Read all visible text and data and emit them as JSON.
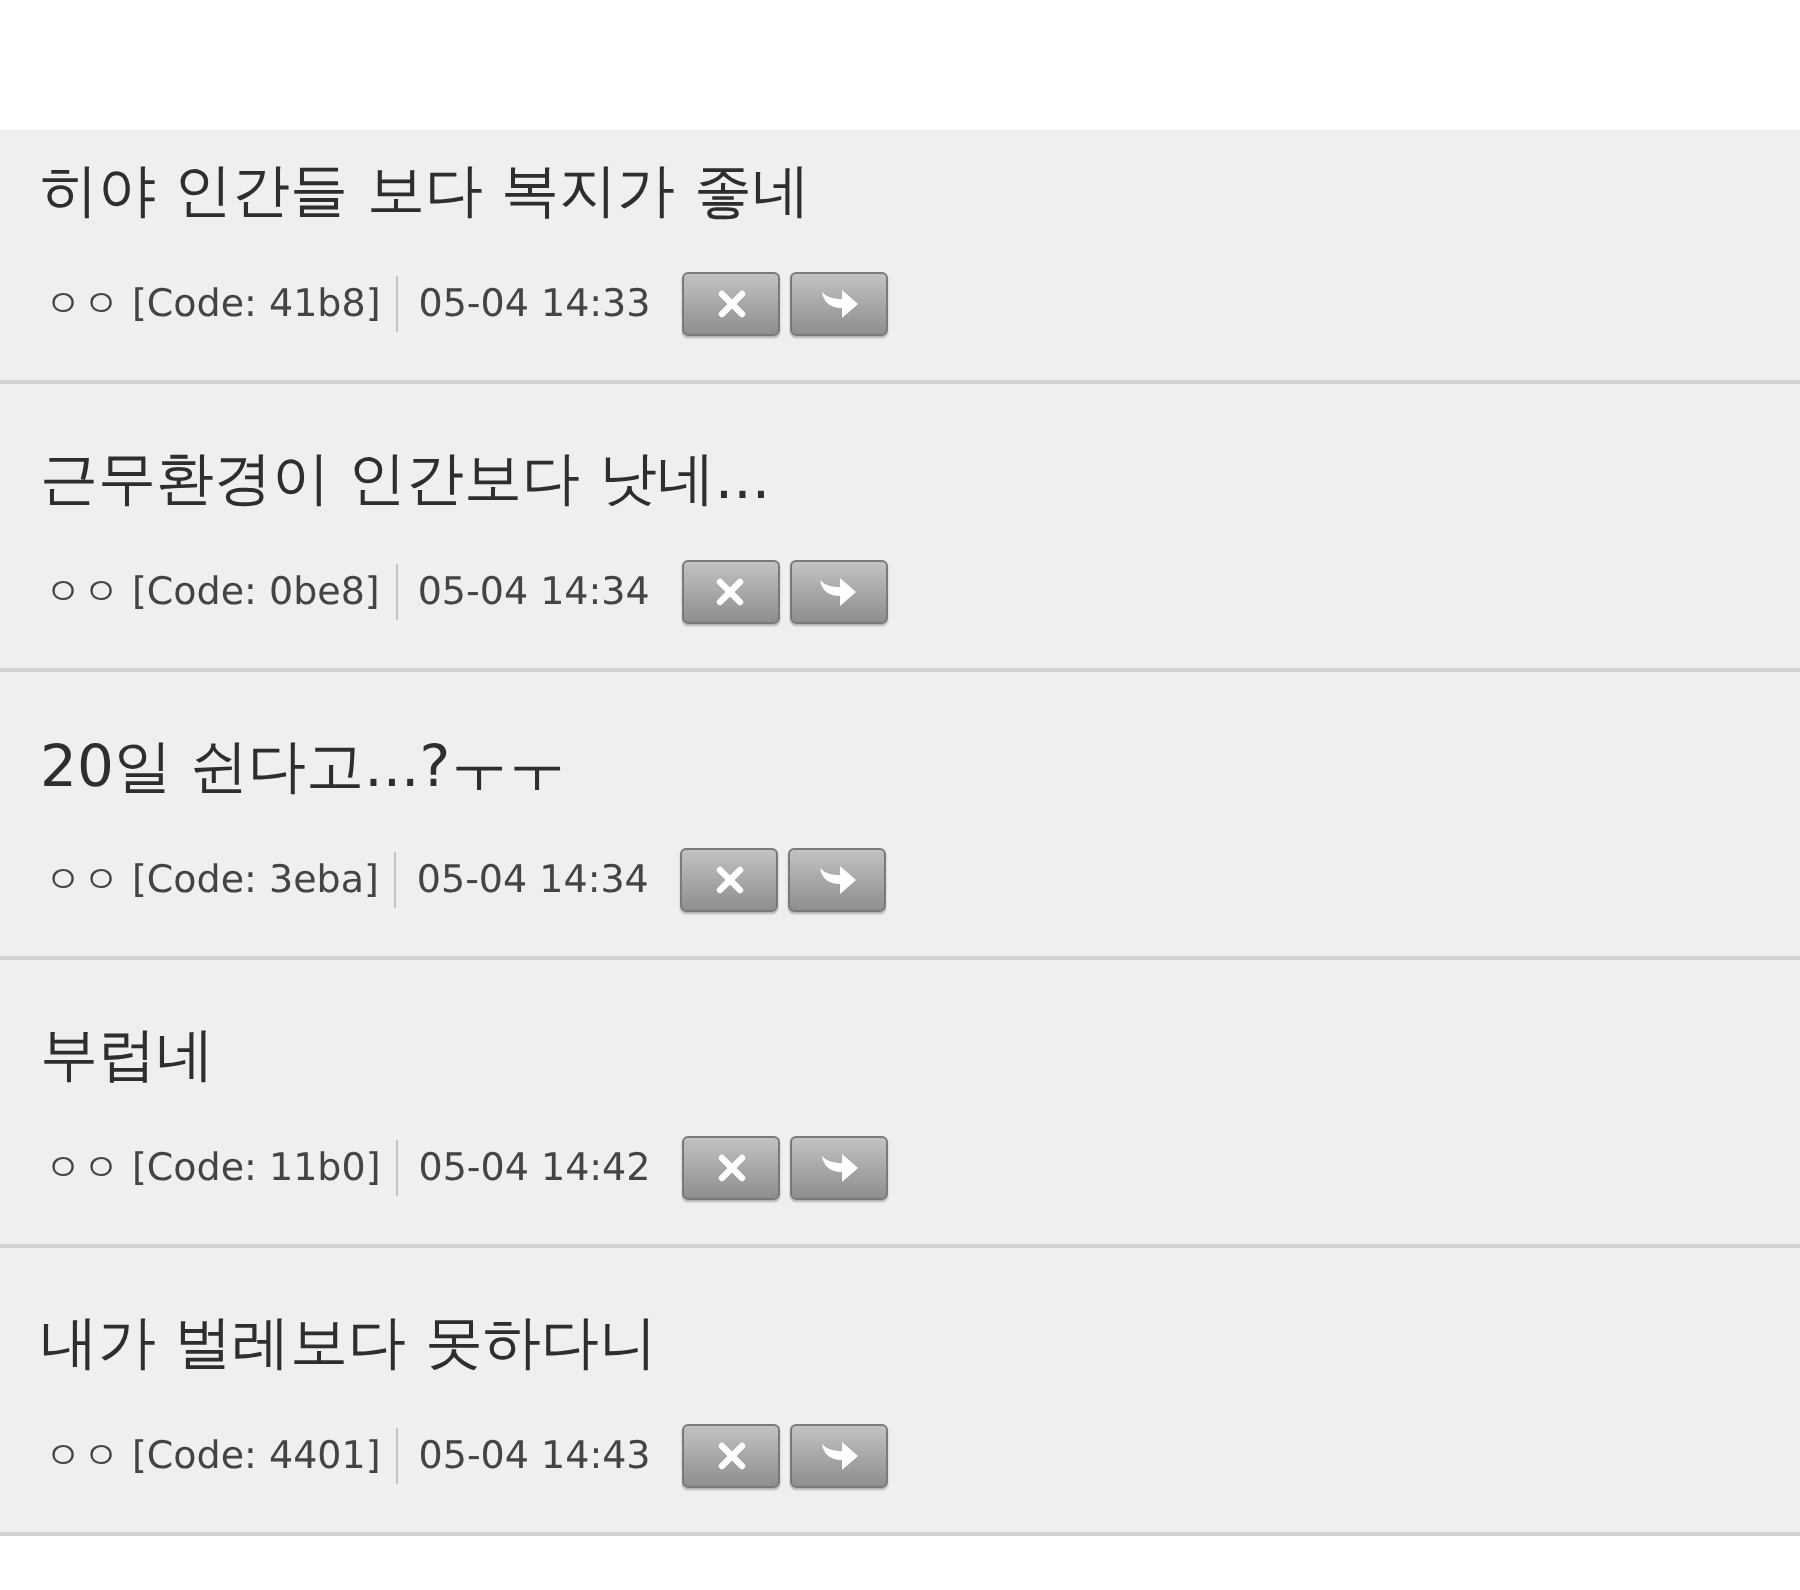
{
  "comments": [
    {
      "text": "히야 인간들 보다 복지가 좋네",
      "author": "ㅇㅇ",
      "code": "[Code: 41b8]",
      "time": "05-04 14:33"
    },
    {
      "text": "근무환경이 인간보다 낫네...",
      "author": "ㅇㅇ",
      "code": "[Code: 0be8]",
      "time": "05-04 14:34"
    },
    {
      "text": "20일 쉰다고...?ㅜㅜ",
      "author": "ㅇㅇ",
      "code": "[Code: 3eba]",
      "time": "05-04 14:34"
    },
    {
      "text": "부럽네",
      "author": "ㅇㅇ",
      "code": "[Code: 11b0]",
      "time": "05-04 14:42"
    },
    {
      "text": "내가 벌레보다 못하다니",
      "author": "ㅇㅇ",
      "code": "[Code: 4401]",
      "time": "05-04 14:43"
    }
  ]
}
